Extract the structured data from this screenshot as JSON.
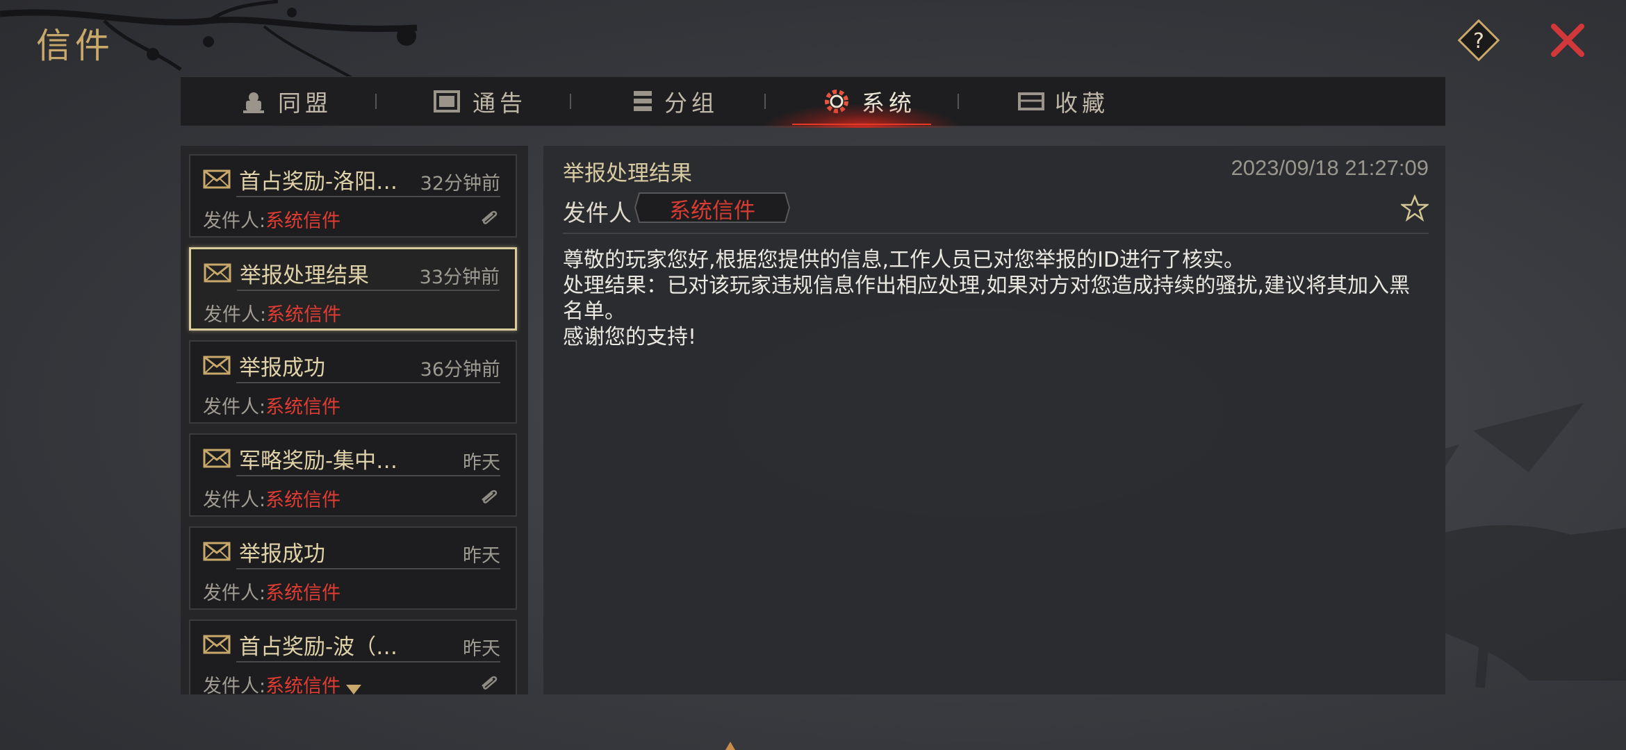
{
  "window": {
    "title": "信件"
  },
  "header": {
    "help_icon": "question-diamond-icon",
    "close_icon": "close-x-icon",
    "close_color": "#d2383a",
    "accent_color": "#c9a96b"
  },
  "tabs": [
    {
      "label": "同盟",
      "icon": "alliance-icon"
    },
    {
      "label": "通告",
      "icon": "announcement-icon"
    },
    {
      "label": "分组",
      "icon": "group-icon"
    },
    {
      "label": "系统",
      "icon": "system-gear-icon",
      "active": true
    },
    {
      "label": "收藏",
      "icon": "favorites-chest-icon"
    }
  ],
  "mails": [
    {
      "subject": "首占奖励-洛阳…",
      "time": "32分钟前",
      "sender_label": "发件人:",
      "sender": "系统信件",
      "has_attachment": true
    },
    {
      "subject": "举报处理结果",
      "time": "33分钟前",
      "sender_label": "发件人:",
      "sender": "系统信件",
      "selected": true
    },
    {
      "subject": "举报成功",
      "time": "36分钟前",
      "sender_label": "发件人:",
      "sender": "系统信件"
    },
    {
      "subject": "军略奖励-集中…",
      "time": "昨天",
      "sender_label": "发件人:",
      "sender": "系统信件",
      "has_attachment": true
    },
    {
      "subject": "举报成功",
      "time": "昨天",
      "sender_label": "发件人:",
      "sender": "系统信件"
    },
    {
      "subject": "首占奖励-波（…",
      "time": "昨天",
      "sender_label": "发件人:",
      "sender": "系统信件",
      "has_attachment": true
    }
  ],
  "detail": {
    "subject": "举报处理结果",
    "date": "2023/09/18 21:27:09",
    "sender_label": "发件人",
    "sender": "系统信件",
    "body": "尊敬的玩家您好,根据您提供的信息,工作人员已对您举报的ID进行了核实。\n处理结果：已对该玩家违规信息作出相应处理,如果对方对您造成持续的骚扰,建议将其加入黑名单。\n感谢您的支持!",
    "favorite_icon": "star-outline-icon"
  },
  "colors": {
    "sender_red": "#e03c33",
    "selected_border": "#d9cb9a",
    "tab_glow": "#e33a28"
  }
}
